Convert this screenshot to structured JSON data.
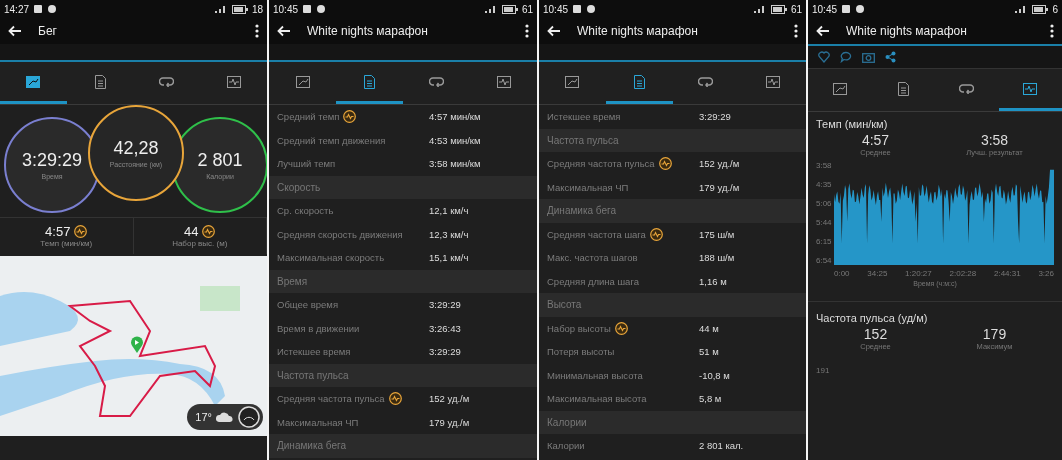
{
  "panels": [
    {
      "kind": "summary",
      "status_bar": {
        "time": "14:27",
        "battery": "18"
      },
      "title": "Бег",
      "tabs": [
        {
          "selected": true
        },
        {
          "selected": false
        },
        {
          "selected": false
        },
        {
          "selected": false
        }
      ],
      "circles": [
        {
          "value": "3:29:29",
          "label": "Время",
          "color": "#7a7fd0"
        },
        {
          "value": "42,28",
          "label": "Расстояние (км)",
          "color": "#e8a53a"
        },
        {
          "value": "2 801",
          "label": "Калории",
          "color": "#2fc04a"
        }
      ],
      "stats": [
        {
          "value": "4:57",
          "label": "Темп (мин/км)",
          "badge": true
        },
        {
          "value": "44",
          "label": "Набор выс. (м)",
          "badge": true
        }
      ],
      "map": {
        "weather": "17°"
      }
    },
    {
      "kind": "details",
      "status_bar": {
        "time": "10:45",
        "battery": "61"
      },
      "title": "White nights марафон",
      "tabs": [
        {
          "selected": false
        },
        {
          "selected": true
        },
        {
          "selected": false
        },
        {
          "selected": false
        }
      ],
      "rows": [
        {
          "kind": "row",
          "label": "Средний темп",
          "value": "4:57 мин/км",
          "badge": true
        },
        {
          "kind": "row",
          "label": "Средний темп движения",
          "value": "4:53 мин/км",
          "badge": false
        },
        {
          "kind": "row",
          "label": "Лучший темп",
          "value": "3:58 мин/км",
          "badge": false
        },
        {
          "kind": "section",
          "label": "Скорость"
        },
        {
          "kind": "row",
          "label": "Ср. скорость",
          "value": "12,1 км/ч",
          "badge": false
        },
        {
          "kind": "row",
          "label": "Средняя скорость движения",
          "value": "12,3 км/ч",
          "badge": false
        },
        {
          "kind": "row",
          "label": "Максимальная скорость",
          "value": "15,1 км/ч",
          "badge": false
        },
        {
          "kind": "section",
          "label": "Время"
        },
        {
          "kind": "row",
          "label": "Общее время",
          "value": "3:29:29",
          "badge": false
        },
        {
          "kind": "row",
          "label": "Время в движении",
          "value": "3:26:43",
          "badge": false
        },
        {
          "kind": "row",
          "label": "Истекшее время",
          "value": "3:29:29",
          "badge": false
        },
        {
          "kind": "section",
          "label": "Частота пульса"
        },
        {
          "kind": "row",
          "label": "Средняя частота пульса",
          "value": "152 уд./м",
          "badge": true
        },
        {
          "kind": "row",
          "label": "Максимальная ЧП",
          "value": "179 уд./м",
          "badge": false
        },
        {
          "kind": "section",
          "label": "Динамика бега"
        }
      ]
    },
    {
      "kind": "details",
      "status_bar": {
        "time": "10:45",
        "battery": "61"
      },
      "title": "White nights марафон",
      "tabs": [
        {
          "selected": false
        },
        {
          "selected": true
        },
        {
          "selected": false
        },
        {
          "selected": false
        }
      ],
      "rows": [
        {
          "kind": "row",
          "label": "Истекшее время",
          "value": "3:29:29",
          "badge": false
        },
        {
          "kind": "section",
          "label": "Частота пульса"
        },
        {
          "kind": "row",
          "label": "Средняя частота пульса",
          "value": "152 уд./м",
          "badge": true
        },
        {
          "kind": "row",
          "label": "Максимальная ЧП",
          "value": "179 уд./м",
          "badge": false
        },
        {
          "kind": "section",
          "label": "Динамика бега"
        },
        {
          "kind": "row",
          "label": "Средняя частота шага",
          "value": "175 ш/м",
          "badge": true
        },
        {
          "kind": "row",
          "label": "Макс. частота шагов",
          "value": "188 ш/м",
          "badge": false
        },
        {
          "kind": "row",
          "label": "Средняя длина шага",
          "value": "1,16 м",
          "badge": false
        },
        {
          "kind": "section",
          "label": "Высота"
        },
        {
          "kind": "row",
          "label": "Набор высоты",
          "value": "44 м",
          "badge": true
        },
        {
          "kind": "row",
          "label": "Потеря высоты",
          "value": "51 м",
          "badge": false
        },
        {
          "kind": "row",
          "label": "Минимальная высота",
          "value": "-10,8 м",
          "badge": false
        },
        {
          "kind": "row",
          "label": "Максимальная высота",
          "value": "5,8 м",
          "badge": false
        },
        {
          "kind": "section",
          "label": "Калории"
        },
        {
          "kind": "row",
          "label": "Калории",
          "value": "2 801 кал.",
          "badge": false
        }
      ]
    },
    {
      "kind": "charts",
      "status_bar": {
        "time": "10:45",
        "battery": "6"
      },
      "title": "White nights марафон",
      "tabs": [
        {
          "selected": false
        },
        {
          "selected": false
        },
        {
          "selected": false
        },
        {
          "selected": true
        }
      ],
      "pace": {
        "title": "Темп (мин/км)",
        "stats": [
          {
            "value": "4:57",
            "label": "Среднее"
          },
          {
            "value": "3:58",
            "label": "Лучш. результат"
          }
        ],
        "y_labels": [
          "3:58",
          "4:35",
          "5:06",
          "5:44",
          "6:15",
          "6:54"
        ],
        "x_labels": [
          "0:00",
          "34:25",
          "1:20:27",
          "2:02:28",
          "2:44:31",
          "3:26"
        ],
        "xlabel": "Время (ч:м:с)"
      },
      "heart": {
        "title": "Частота пульса (уд/м)",
        "stats": [
          {
            "value": "152",
            "label": "Среднее"
          },
          {
            "value": "179",
            "label": "Максимум"
          }
        ],
        "y_labels": [
          "191"
        ]
      }
    }
  ]
}
